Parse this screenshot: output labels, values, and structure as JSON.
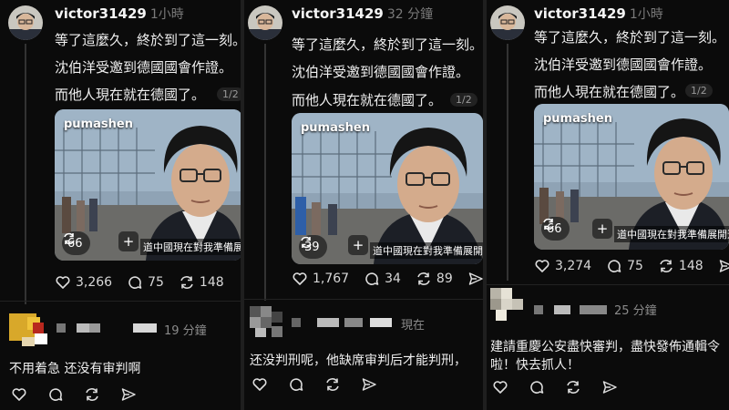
{
  "panels": [
    {
      "post": {
        "username": "victor31429",
        "time": "1小時",
        "lines": [
          "等了這麼久，終於到了這一刻。",
          "沈伯洋受邀到德國國會作證。",
          "而他人現在就在德國了。"
        ],
        "pager": "1/2",
        "video": {
          "account": "pumashen",
          "repost_count": "66",
          "caption": "道中國現在對我準備展開追緝"
        },
        "actions": [
          {
            "icon": "heart-icon",
            "count": "3,266"
          },
          {
            "icon": "comment-icon",
            "count": "75"
          },
          {
            "icon": "repost-icon",
            "count": "148"
          }
        ]
      },
      "comment": {
        "time": "19 分鐘",
        "lines": [
          "不用着急 还没有审判啊"
        ]
      }
    },
    {
      "post": {
        "username": "victor31429",
        "time": "32 分鐘",
        "lines": [
          "等了這麼久，終於到了這一刻。",
          "沈伯洋受邀到德國國會作證。",
          "而他人現在就在德國了。"
        ],
        "pager": "1/2",
        "video": {
          "account": "pumashen",
          "repost_count": "39",
          "caption": "道中國現在對我準備展開追緝"
        },
        "actions": [
          {
            "icon": "heart-icon",
            "count": "1,767"
          },
          {
            "icon": "comment-icon",
            "count": "34"
          },
          {
            "icon": "repost-icon",
            "count": "89"
          },
          {
            "icon": "share-icon",
            "count": ""
          }
        ]
      },
      "comment": {
        "time": "現在",
        "lines": [
          "还没判刑呢，他缺席审判后才能判刑，"
        ]
      }
    },
    {
      "post": {
        "username": "victor31429",
        "time": "1小時",
        "lines": [
          "等了這麼久，終於到了這一刻。",
          "沈伯洋受邀到德國國會作證。",
          "而他人現在就在德國了。"
        ],
        "pager": "1/2",
        "video": {
          "account": "pumashen",
          "repost_count": "66",
          "caption": "道中國現在對我準備展開追緝"
        },
        "actions": [
          {
            "icon": "heart-icon",
            "count": "3,274"
          },
          {
            "icon": "comment-icon",
            "count": "75"
          },
          {
            "icon": "repost-icon",
            "count": "148"
          },
          {
            "icon": "share-icon",
            "count": ""
          }
        ]
      },
      "comment": {
        "time": "25 分鐘",
        "lines": [
          "建請重慶公安盡快審判，盡快發佈通輯令",
          "啦！快去抓人！"
        ]
      }
    }
  ]
}
